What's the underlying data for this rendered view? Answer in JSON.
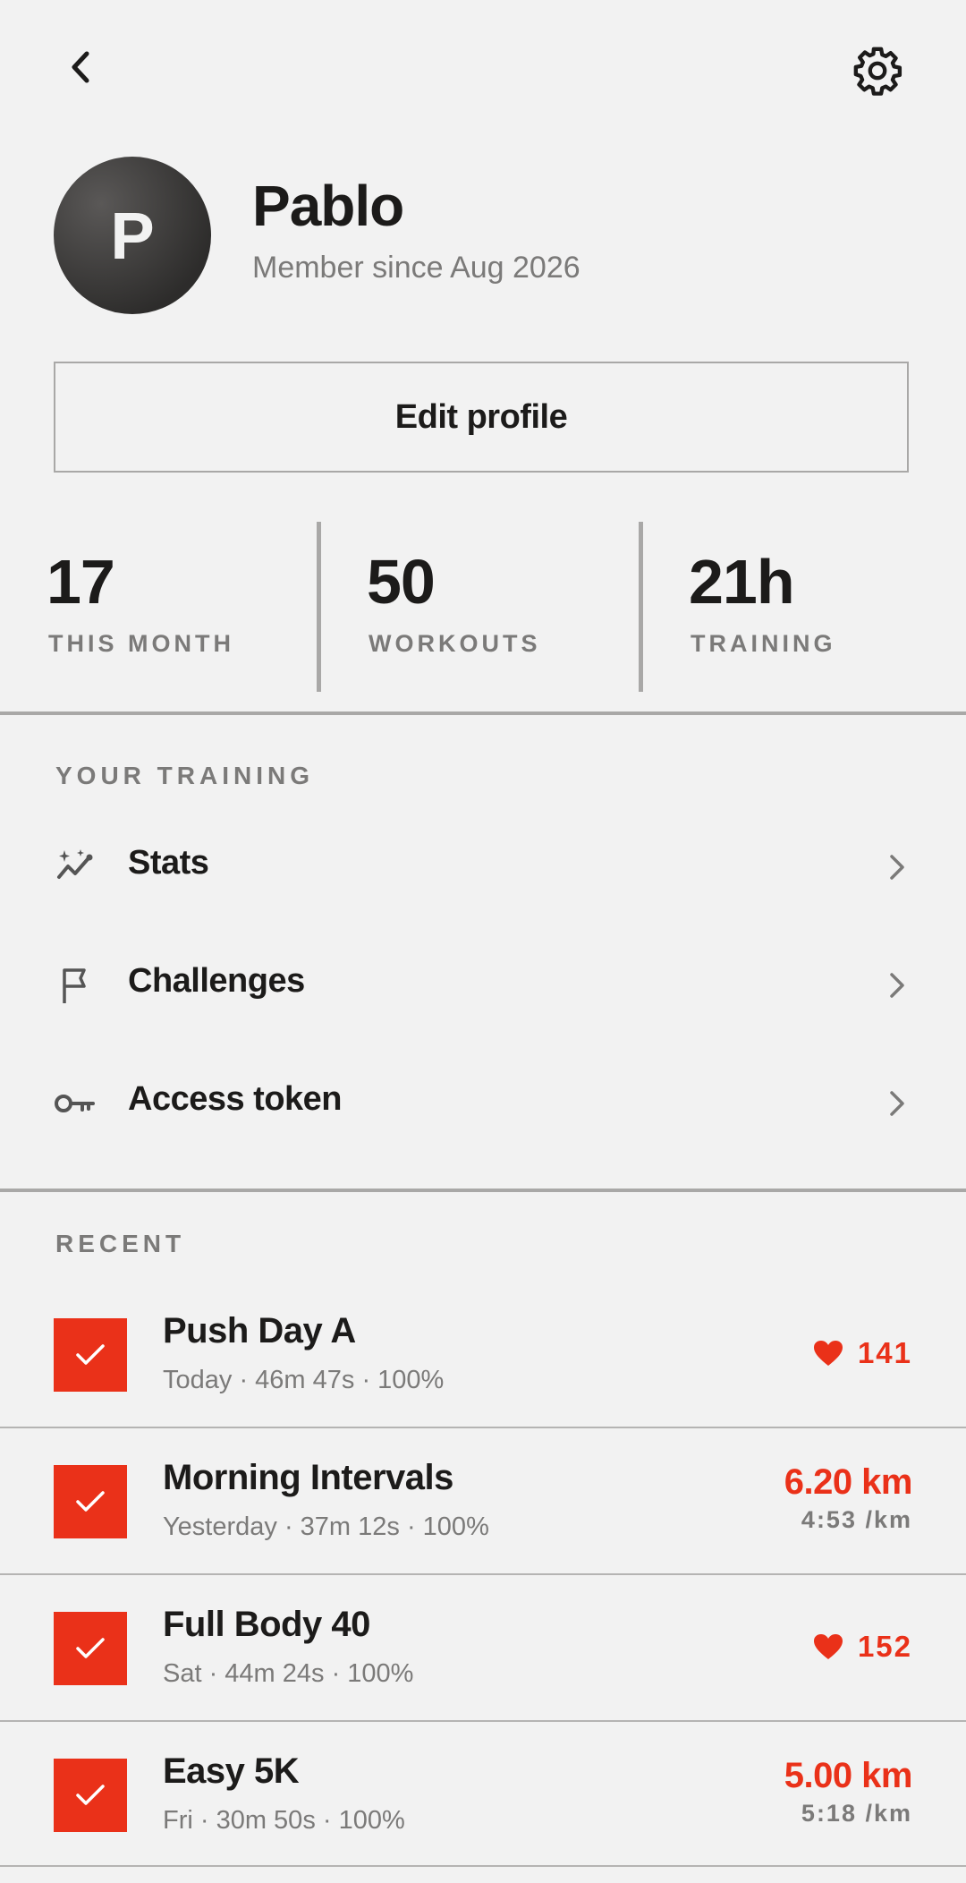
{
  "header": {
    "back_icon": "chevron-left-icon",
    "settings_icon": "gear-icon"
  },
  "profile": {
    "avatar_initial": "P",
    "name": "Pablo",
    "member_since": "Member since Aug 2026",
    "edit_label": "Edit profile"
  },
  "stats": [
    {
      "value": "17",
      "label": "THIS MONTH"
    },
    {
      "value": "50",
      "label": "WORKOUTS"
    },
    {
      "value": "21h",
      "label": "TRAINING"
    }
  ],
  "training": {
    "title": "YOUR TRAINING",
    "items": [
      {
        "label": "Stats",
        "icon": "sparkle-chart-icon"
      },
      {
        "label": "Challenges",
        "icon": "flag-icon"
      },
      {
        "label": "Access token",
        "icon": "key-icon"
      }
    ]
  },
  "recent": {
    "title": "RECENT",
    "items": [
      {
        "title": "Push Day A",
        "sub": "Today · 46m 47s · 100%",
        "hr": "141"
      },
      {
        "title": "Morning Intervals",
        "sub": "Yesterday · 37m 12s · 100%",
        "distance": "6.20 km",
        "pace": "4:53 /km"
      },
      {
        "title": "Full Body 40",
        "sub": "Sat · 44m 24s · 100%",
        "hr": "152"
      },
      {
        "title": "Easy 5K",
        "sub": "Fri · 30m 50s · 100%",
        "distance": "5.00 km",
        "pace": "5:18 /km"
      }
    ]
  },
  "colors": {
    "accent": "#ea3119",
    "background": "#f2f2f2",
    "text": "#1c1b1a",
    "muted": "#7b7a79",
    "divider": "#a9a8a7"
  }
}
